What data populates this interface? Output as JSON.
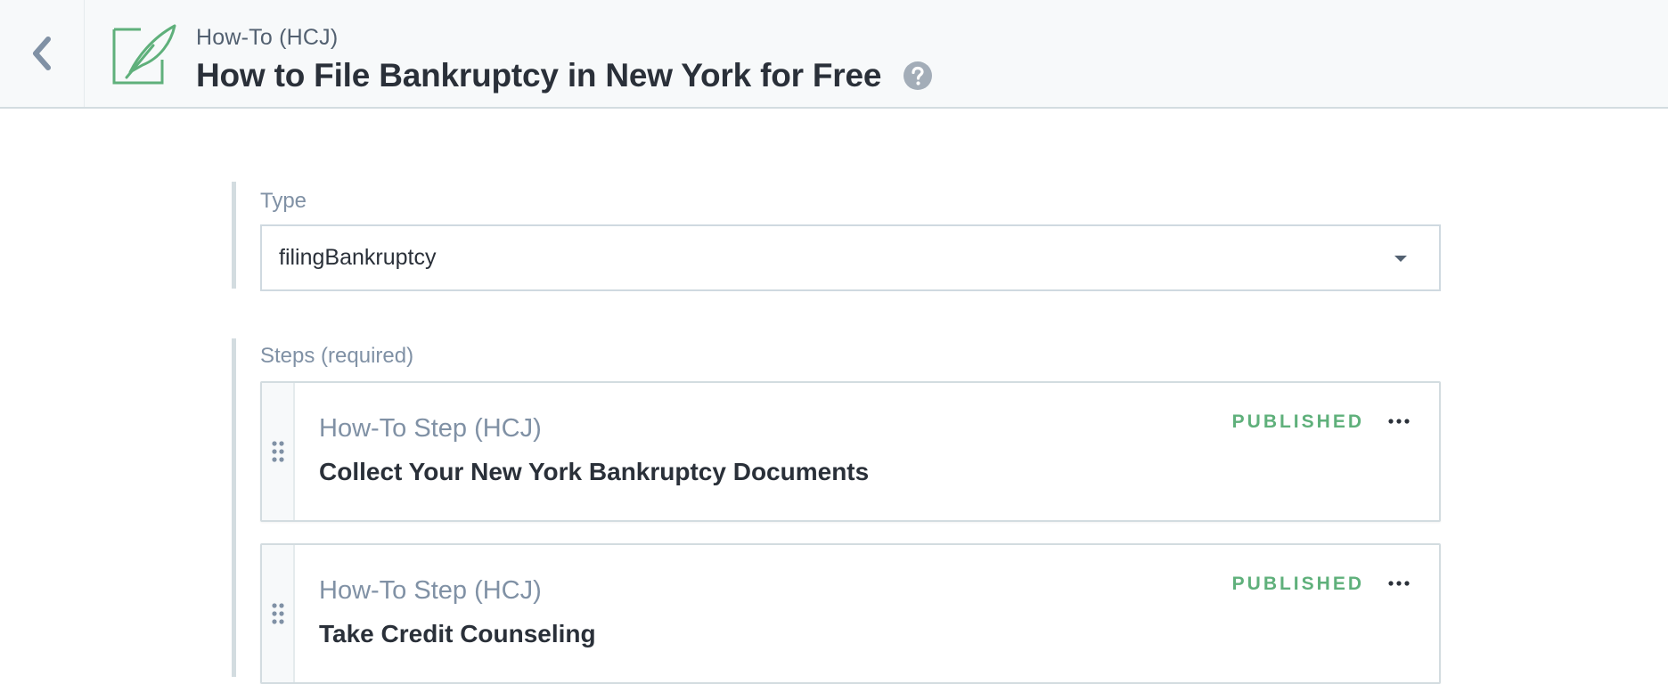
{
  "header": {
    "back_icon": "chevron-left-icon",
    "entity_icon": "feather-quill-icon",
    "content_type": "How-To (HCJ)",
    "title": "How to File Bankruptcy in New York for Free",
    "help_icon": "question-circle-icon"
  },
  "fields": {
    "type": {
      "label": "Type",
      "value": "filingBankruptcy",
      "caret_icon": "caret-down-icon"
    },
    "steps": {
      "label": "Steps (required)",
      "items": [
        {
          "content_type": "How-To Step (HCJ)",
          "title": "Collect Your New York Bankruptcy Documents",
          "status": "PUBLISHED",
          "menu_icon": "more-horizontal-icon",
          "drag_icon": "drag-handle-icon"
        },
        {
          "content_type": "How-To Step (HCJ)",
          "title": "Take Credit Counseling",
          "status": "PUBLISHED",
          "menu_icon": "more-horizontal-icon",
          "drag_icon": "drag-handle-icon"
        }
      ]
    }
  },
  "colors": {
    "accent_green": "#5fb07b",
    "header_bg": "#f7f9fa",
    "border": "#d3dce0",
    "muted_text": "#8091a5",
    "primary_text": "#2a3039"
  }
}
